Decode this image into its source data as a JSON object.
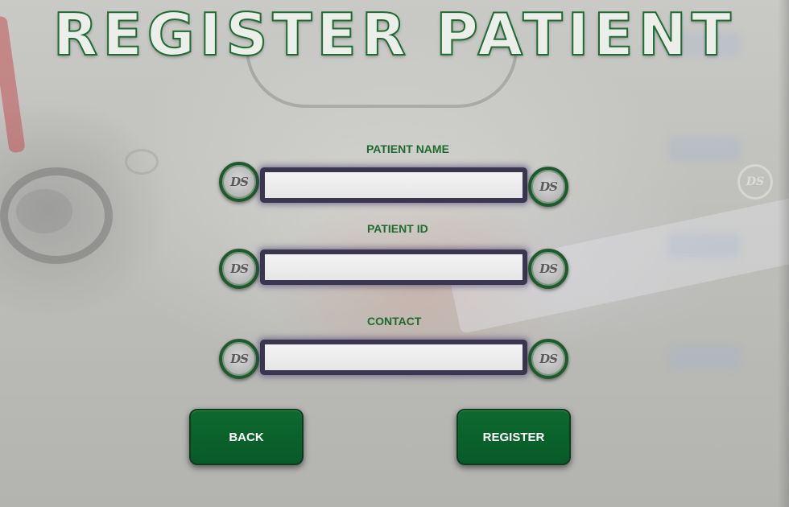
{
  "title": "REGISTER PATIENT",
  "logo_text": "DS",
  "fields": [
    {
      "label": "PATIENT NAME",
      "value": "",
      "placeholder": ""
    },
    {
      "label": "PATIENT ID",
      "value": "",
      "placeholder": ""
    },
    {
      "label": "CONTACT",
      "value": "",
      "placeholder": ""
    }
  ],
  "buttons": {
    "back_label": "BACK",
    "register_label": "REGISTER"
  },
  "colors": {
    "accent_green": "#085a27",
    "label_green": "#1e6a2f",
    "input_frame": "#3a3650"
  }
}
